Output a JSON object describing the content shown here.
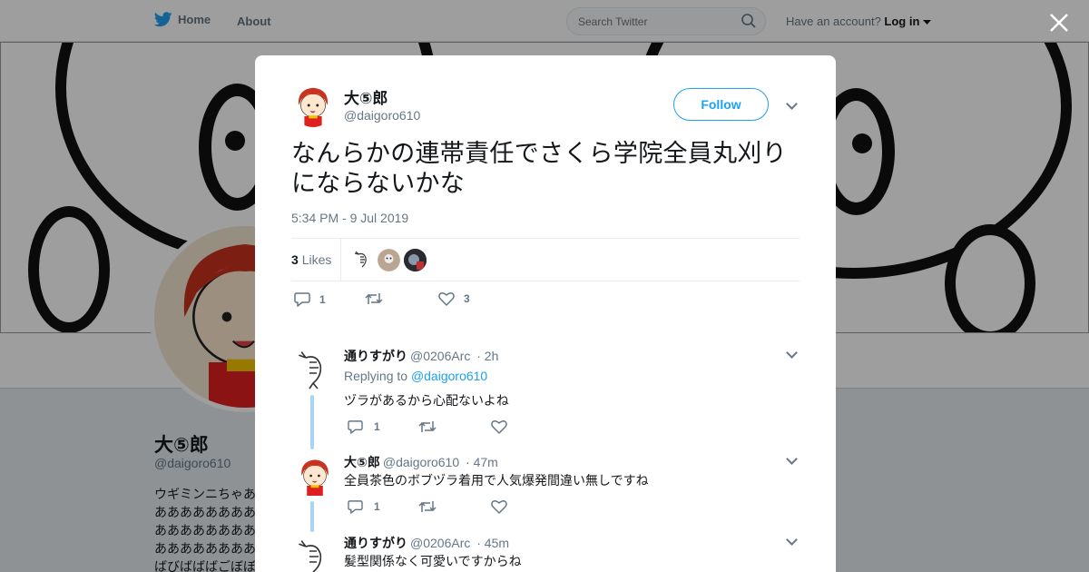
{
  "nav": {
    "home": "Home",
    "about": "About",
    "search_placeholder": "Search Twitter",
    "have_account": "Have an account?",
    "login": "Log in"
  },
  "profile": {
    "name": "大⑤郎",
    "handle": "@daigoro610",
    "bio_lines": [
      "ウギミンニちゃあ",
      "ああああああああ",
      "ああああああああ",
      "ああああああああば",
      "ばびばばばごぼぼ"
    ]
  },
  "tweet": {
    "author_name": "大⑤郎",
    "author_handle": "@daigoro610",
    "follow_label": "Follow",
    "text": "なんらかの連帯責任でさくら学院全員丸刈りにならないかな",
    "timestamp": "5:34 PM - 9 Jul 2019",
    "likes_count": "3",
    "likes_label": "Likes",
    "reply_count": "1",
    "retweet_count": "",
    "like_count": "3"
  },
  "replies": [
    {
      "name": "通りすがり",
      "handle": "@0206Arc",
      "time": "· 2h",
      "replying_prefix": "Replying to",
      "replying_to": "@daigoro610",
      "text": "ヅラがあるから心配ないよね",
      "reply_count": "1",
      "avatar": "shrimp"
    },
    {
      "name": "大⑤郎",
      "handle": "@daigoro610",
      "time": "· 47m",
      "text": "全員茶色のボブヅラ着用で人気爆発間違い無しですね",
      "reply_count": "1",
      "avatar": "girl"
    },
    {
      "name": "通りすがり",
      "handle": "@0206Arc",
      "time": "· 45m",
      "text": "髪型関係なく可愛いですからね",
      "reply_count": "",
      "avatar": "shrimp"
    }
  ],
  "colors": {
    "accent": "#1da1f2",
    "thread": "#a7d6f4",
    "muted": "#657786"
  }
}
